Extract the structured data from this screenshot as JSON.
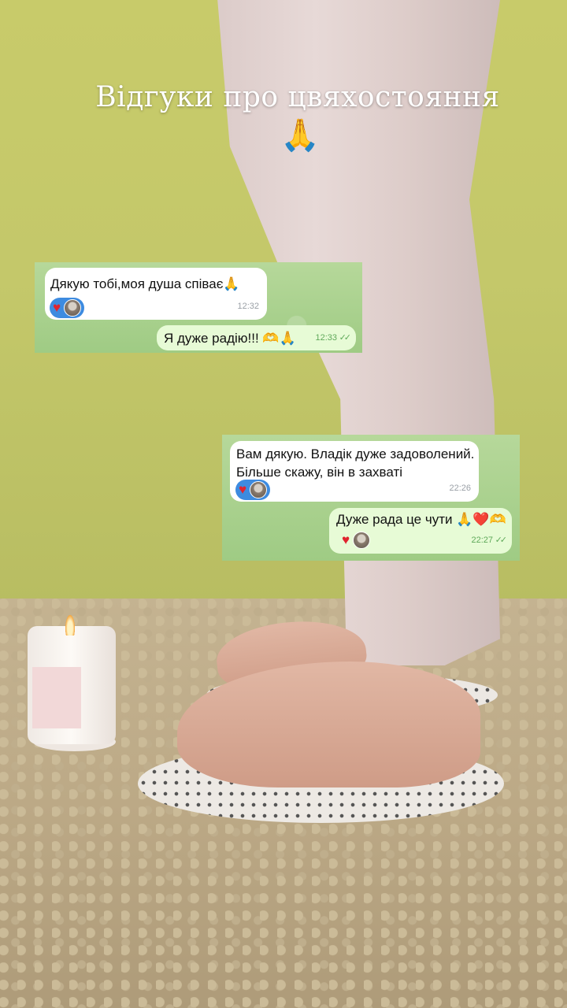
{
  "story": {
    "title": "Відгуки про цвяхостояння",
    "title_emoji": "🙏"
  },
  "chat_one": {
    "incoming": {
      "text": "Дякую тобі,моя душа співає🙏",
      "time": "12:32",
      "reactions": [
        "heart-icon",
        "avatar"
      ]
    },
    "outgoing": {
      "text": "Я дуже радію!!! 🫶🙏",
      "time": "12:33",
      "status": "✓✓"
    }
  },
  "chat_two": {
    "incoming": {
      "line1": "Вам дякую. Владік дуже задоволений.",
      "line2": "Більше скажу, він в захваті",
      "time": "22:26",
      "reactions": [
        "heart-icon",
        "avatar"
      ]
    },
    "outgoing": {
      "text": "Дуже рада це чути 🙏❤️🫶",
      "time": "22:27",
      "status": "✓✓",
      "reactions": [
        "heart-icon",
        "avatar"
      ]
    }
  },
  "colors": {
    "wall": "#c6c96a",
    "chat_background": "#a9cf8c",
    "incoming_bubble": "#ffffff",
    "outgoing_bubble": "#e7fbd6",
    "reaction_pill": "#3d8be0",
    "heart": "#e0242f"
  }
}
